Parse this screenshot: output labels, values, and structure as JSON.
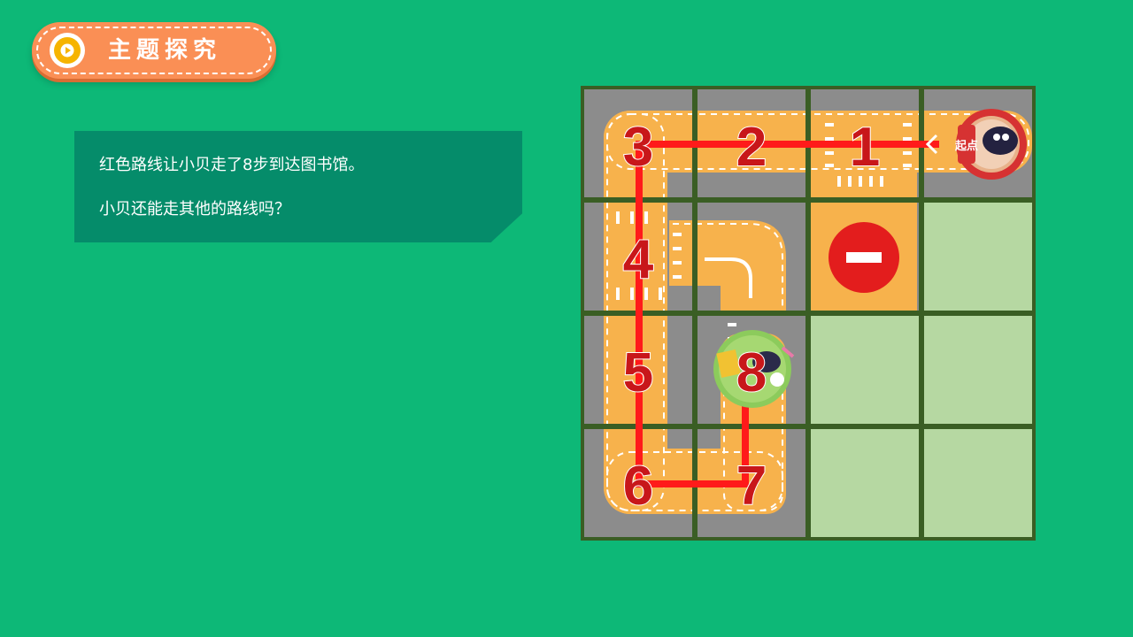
{
  "header": {
    "title": "主题探究",
    "play_icon": "play-icon"
  },
  "prompt_card": {
    "line1": "红色路线让小贝走了8步到达图书馆。",
    "line2": "小贝还能走其他的路线吗？"
  },
  "board": {
    "grid": [
      4,
      4
    ],
    "start_label": "起点",
    "route_color": "#ff1a1a",
    "number_color": "#c8171a",
    "road_color": "#f7b24c",
    "grass_color": "#b6d8a2",
    "asphalt_color": "#8c8c8c",
    "steps": [
      {
        "label": "1",
        "col": 3,
        "row": 1
      },
      {
        "label": "2",
        "col": 2,
        "row": 1
      },
      {
        "label": "3",
        "col": 1,
        "row": 1
      },
      {
        "label": "4",
        "col": 1,
        "row": 2
      },
      {
        "label": "5",
        "col": 1,
        "row": 3
      },
      {
        "label": "6",
        "col": 1,
        "row": 4
      },
      {
        "label": "7",
        "col": 2,
        "row": 4
      },
      {
        "label": "8",
        "col": 2,
        "row": 3
      }
    ],
    "icons": [
      "start-icon",
      "no-entry-icon",
      "library-destination-icon"
    ]
  }
}
